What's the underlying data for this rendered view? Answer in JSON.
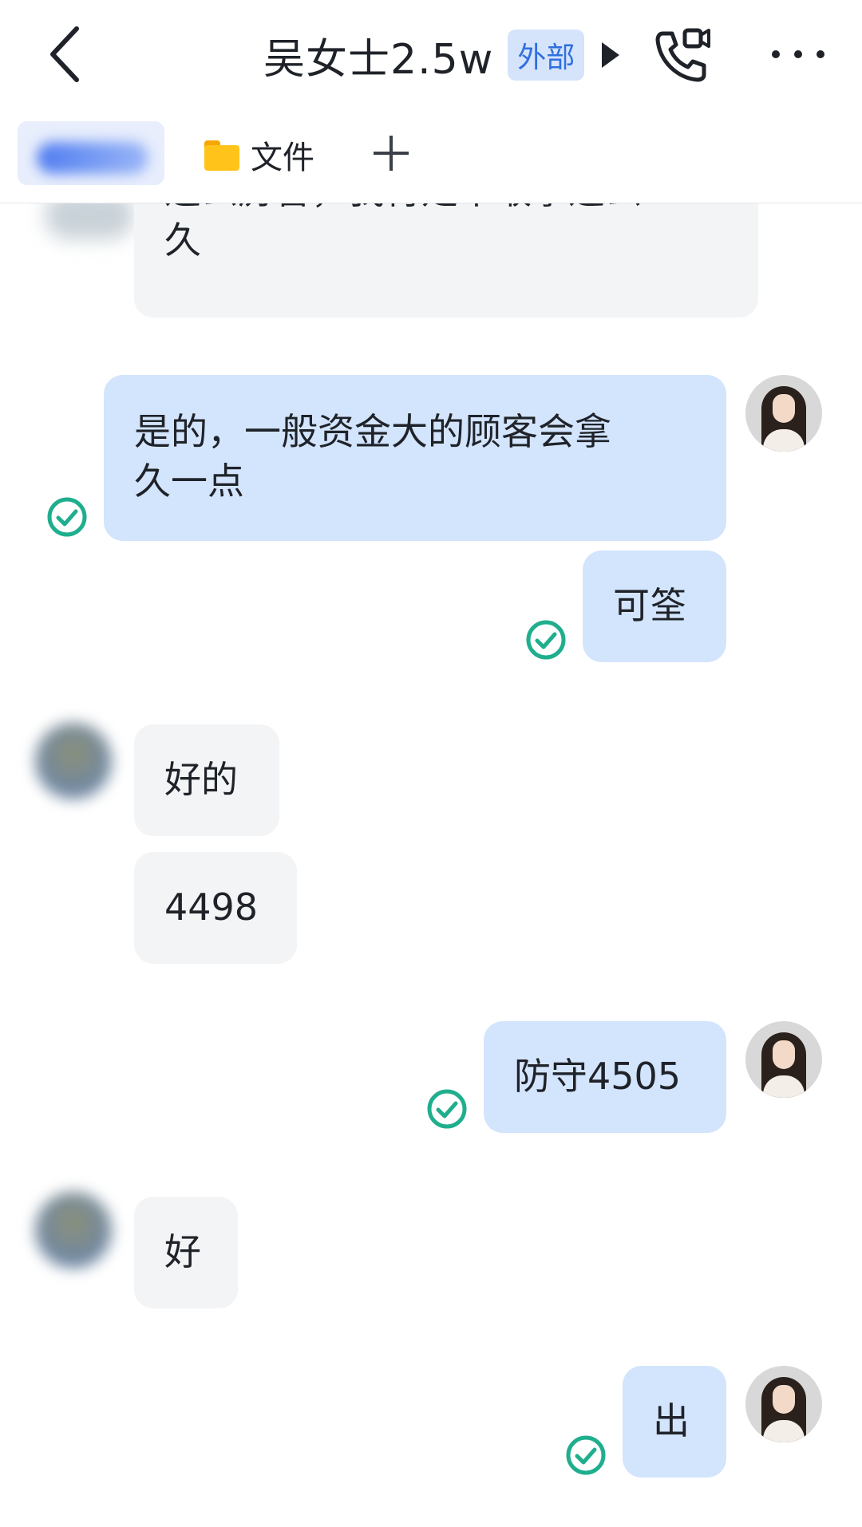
{
  "header": {
    "title": "吴女士2.5w",
    "badge": "外部"
  },
  "tabs": {
    "file_label": "文件"
  },
  "messages": [
    {
      "dir": "in",
      "lines": [
        "这么厉害，我肯定不敢拿这么",
        "久"
      ]
    },
    {
      "dir": "out",
      "lines": [
        "是的，一般资金大的顾客会拿",
        "久一点"
      ]
    },
    {
      "dir": "out",
      "text": "可筌"
    },
    {
      "dir": "in",
      "text": "好的"
    },
    {
      "dir": "in",
      "text": "4498"
    },
    {
      "dir": "out",
      "text": "防守4505"
    },
    {
      "dir": "in",
      "text": "好"
    },
    {
      "dir": "out",
      "text": "出"
    }
  ],
  "colors": {
    "incoming_bubble": "#f3f4f6",
    "outgoing_bubble": "#d3e4fd",
    "read_check": "#1fae8e",
    "badge_text": "#2f6fe0"
  }
}
